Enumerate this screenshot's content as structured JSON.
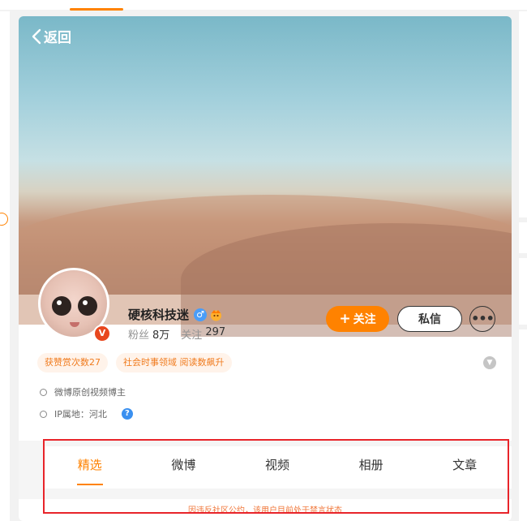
{
  "header": {
    "back_label": "返回"
  },
  "profile": {
    "name": "硬核科技迷",
    "fans_label": "粉丝",
    "fans_value": "8万",
    "following_label": "关注",
    "following_value": "297",
    "verified_badge": "V",
    "gender_symbol": "♂",
    "follow_button": "关注",
    "message_button": "私信",
    "more_button": "•••"
  },
  "tags": [
    "获赞赏次数27",
    "社会时事领域 阅读数飙升"
  ],
  "info": {
    "creator": "微博原创视频博主",
    "ip_location": "IP属地：河北"
  },
  "tabs": [
    "精选",
    "微博",
    "视频",
    "相册",
    "文章"
  ],
  "active_tab": "精选",
  "notice": "因违反社区公约，该用户目前处于禁言状态",
  "colors": {
    "accent": "#ff8200",
    "highlight_border": "#e8242a",
    "tag_text": "#f07b1e"
  },
  "icons": [
    "chevron-left-icon",
    "gender-male-icon",
    "vip-crown-icon",
    "more-icon",
    "chevron-down-icon",
    "shield-icon",
    "ip-icon",
    "help-icon"
  ]
}
